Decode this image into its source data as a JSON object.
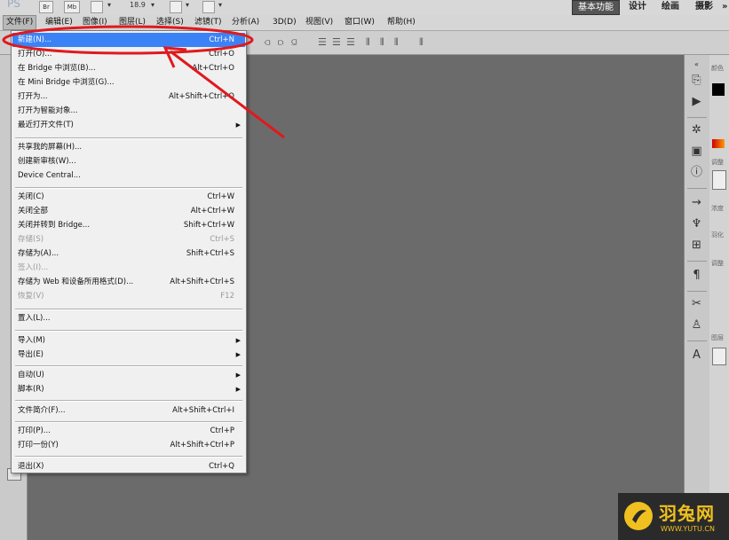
{
  "appbar": {
    "logo": "PS",
    "br_button": "Br",
    "mb_button": "Mb",
    "zoom": "18.9",
    "workspaces": [
      "基本功能",
      "设计",
      "绘画",
      "摄影"
    ],
    "active_workspace": "基本功能"
  },
  "menubar": {
    "items": [
      "文件(F)",
      "编辑(E)",
      "图像(I)",
      "图层(L)",
      "选择(S)",
      "滤镜(T)",
      "分析(A)",
      "3D(D)",
      "视图(V)",
      "窗口(W)",
      "帮助(H)"
    ],
    "active": "文件(F)"
  },
  "file_menu": {
    "items": [
      {
        "label": "新建(N)...",
        "shortcut": "Ctrl+N",
        "highlighted": true
      },
      {
        "label": "打开(O)...",
        "shortcut": "Ctrl+O"
      },
      {
        "label": "在 Bridge 中浏览(B)...",
        "shortcut": "Alt+Ctrl+O"
      },
      {
        "label": "在 Mini Bridge 中浏览(G)...",
        "shortcut": ""
      },
      {
        "label": "打开为...",
        "shortcut": "Alt+Shift+Ctrl+O"
      },
      {
        "label": "打开为智能对象...",
        "shortcut": ""
      },
      {
        "label": "最近打开文件(T)",
        "shortcut": "",
        "submenu": true
      },
      {
        "label": "共享我的屏幕(H)...",
        "shortcut": ""
      },
      {
        "label": "创建新审核(W)...",
        "shortcut": ""
      },
      {
        "label": "Device Central...",
        "shortcut": ""
      },
      {
        "label": "关闭(C)",
        "shortcut": "Ctrl+W"
      },
      {
        "label": "关闭全部",
        "shortcut": "Alt+Ctrl+W"
      },
      {
        "label": "关闭并转到 Bridge...",
        "shortcut": "Shift+Ctrl+W"
      },
      {
        "label": "存储(S)",
        "shortcut": "Ctrl+S",
        "disabled": true
      },
      {
        "label": "存储为(A)...",
        "shortcut": "Shift+Ctrl+S"
      },
      {
        "label": "签入(I)...",
        "shortcut": "",
        "disabled": true
      },
      {
        "label": "存储为 Web 和设备所用格式(D)...",
        "shortcut": "Alt+Shift+Ctrl+S"
      },
      {
        "label": "恢复(V)",
        "shortcut": "F12",
        "disabled": true
      },
      {
        "label": "置入(L)...",
        "shortcut": ""
      },
      {
        "label": "导入(M)",
        "shortcut": "",
        "submenu": true
      },
      {
        "label": "导出(E)",
        "shortcut": "",
        "submenu": true
      },
      {
        "label": "自动(U)",
        "shortcut": "",
        "submenu": true
      },
      {
        "label": "脚本(R)",
        "shortcut": "",
        "submenu": true
      },
      {
        "label": "文件简介(F)...",
        "shortcut": "Alt+Shift+Ctrl+I"
      },
      {
        "label": "打印(P)...",
        "shortcut": "Ctrl+P"
      },
      {
        "label": "打印一份(Y)",
        "shortcut": "Alt+Shift+Ctrl+P"
      },
      {
        "label": "退出(X)",
        "shortcut": "Ctrl+Q"
      }
    ]
  },
  "right_panel": {
    "labels": [
      "颜色",
      "调整",
      "浓度",
      "羽化",
      "调整",
      "图层"
    ]
  },
  "watermark": {
    "brand": "羽兔网",
    "url": "WWW.YUTU.CN"
  },
  "colors": {
    "highlight": "#3b82f6",
    "annotation": "#e0191d",
    "watermark": "#f0c020"
  }
}
